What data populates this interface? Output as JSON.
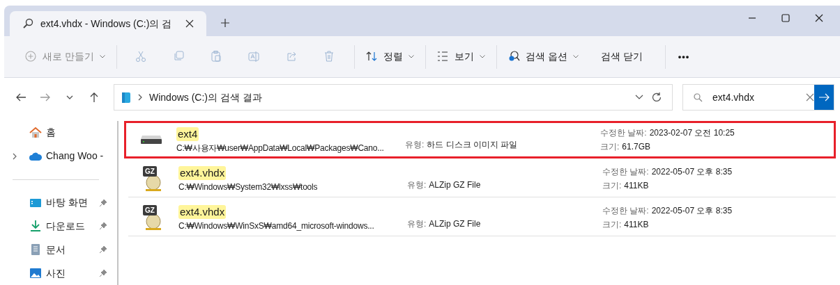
{
  "tabs": [
    {
      "title": "ext4.vhdx - Windows (C:)의 검",
      "selected": true
    }
  ],
  "toolbar": [
    {
      "kind": "new",
      "label": "새로 만들기",
      "caret": true,
      "disabled": true
    },
    {
      "kind": "sep"
    },
    {
      "kind": "cut",
      "disabled": true
    },
    {
      "kind": "copy",
      "disabled": true
    },
    {
      "kind": "paste",
      "disabled": true
    },
    {
      "kind": "rename",
      "disabled": true
    },
    {
      "kind": "share",
      "disabled": true
    },
    {
      "kind": "delete",
      "disabled": true
    },
    {
      "kind": "sep"
    },
    {
      "kind": "sort",
      "label": "정렬",
      "caret": true,
      "disabled": false
    },
    {
      "kind": "sep"
    },
    {
      "kind": "view",
      "label": "보기",
      "caret": true,
      "disabled": false
    },
    {
      "kind": "sep"
    },
    {
      "kind": "search-options",
      "label": "검색 옵션",
      "caret": true,
      "disabled": false
    },
    {
      "kind": "close-search",
      "label": "검색 닫기",
      "caret": false,
      "disabled": false
    },
    {
      "kind": "sep"
    },
    {
      "kind": "more",
      "label": "•••"
    }
  ],
  "address": {
    "path": "Windows (C:)의 검색 결과"
  },
  "search": {
    "value": "ext4.vhdx"
  },
  "sidebar": {
    "items": [
      {
        "kind": "home",
        "label": "홈",
        "expandable": false,
        "pinned": false
      },
      {
        "kind": "cloud",
        "label": "Chang Woo -",
        "expandable": true,
        "pinned": false
      },
      {
        "kind": "divider"
      },
      {
        "kind": "desktop",
        "label": "바탕 화면",
        "expandable": false,
        "pinned": true
      },
      {
        "kind": "download",
        "label": "다운로드",
        "expandable": false,
        "pinned": true
      },
      {
        "kind": "document",
        "label": "문서",
        "expandable": false,
        "pinned": true
      },
      {
        "kind": "picture",
        "label": "사진",
        "expandable": false,
        "pinned": true
      }
    ]
  },
  "results": [
    {
      "kind": "disk",
      "name": "ext4",
      "path": "C:₩사용자₩user₩AppData₩Local₩Packages₩Cano...",
      "type_label": "유형:",
      "type": "하드 디스크 이미지 파일",
      "date_label": "수정한 날짜:",
      "date": "2023-02-07 오전 10:25",
      "size_label": "크기:",
      "size": "61.7GB",
      "annotated": true
    },
    {
      "kind": "gz",
      "badge": "GZ",
      "name": "ext4.vhdx",
      "path": "C:₩Windows₩System32₩lxss₩tools",
      "type_label": "유형:",
      "type": "ALZip GZ File",
      "date_label": "수정한 날짜:",
      "date": "2022-05-07 오후 8:35",
      "size_label": "크기:",
      "size": "411KB",
      "annotated": false
    },
    {
      "kind": "gz",
      "badge": "GZ",
      "name": "ext4.vhdx",
      "path": "C:₩Windows₩WinSxS₩amd64_microsoft-windows...",
      "type_label": "유형:",
      "type": "ALZip GZ File",
      "date_label": "수정한 날짜:",
      "date": "2022-05-07 오후 8:35",
      "size_label": "크기:",
      "size": "411KB",
      "annotated": false
    }
  ]
}
